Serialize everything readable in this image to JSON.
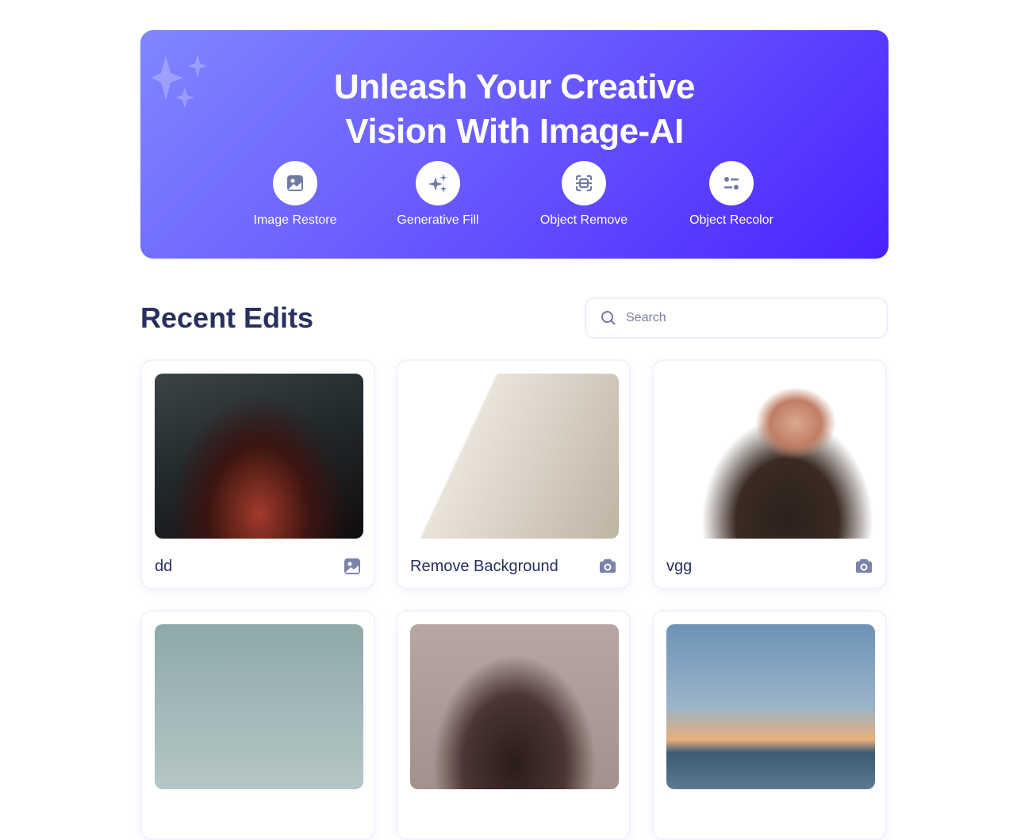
{
  "hero": {
    "title_line1": "Unleash Your Creative",
    "title_line2": "Vision With Image-AI",
    "tools": [
      {
        "label": "Image Restore",
        "icon": "image-icon"
      },
      {
        "label": "Generative Fill",
        "icon": "sparkles-icon"
      },
      {
        "label": "Object Remove",
        "icon": "scan-object-icon"
      },
      {
        "label": "Object Recolor",
        "icon": "sliders-icon"
      }
    ]
  },
  "recent": {
    "title": "Recent Edits",
    "search_placeholder": "Search",
    "cards": [
      {
        "name": "dd",
        "icon": "image-icon"
      },
      {
        "name": "Remove Background",
        "icon": "camera-icon"
      },
      {
        "name": "vgg",
        "icon": "camera-icon"
      },
      {
        "name": ""
      },
      {
        "name": ""
      },
      {
        "name": ""
      }
    ]
  },
  "colors": {
    "accent": "#5b3cff",
    "heading": "#27305e",
    "icon": "#7a83a8"
  }
}
